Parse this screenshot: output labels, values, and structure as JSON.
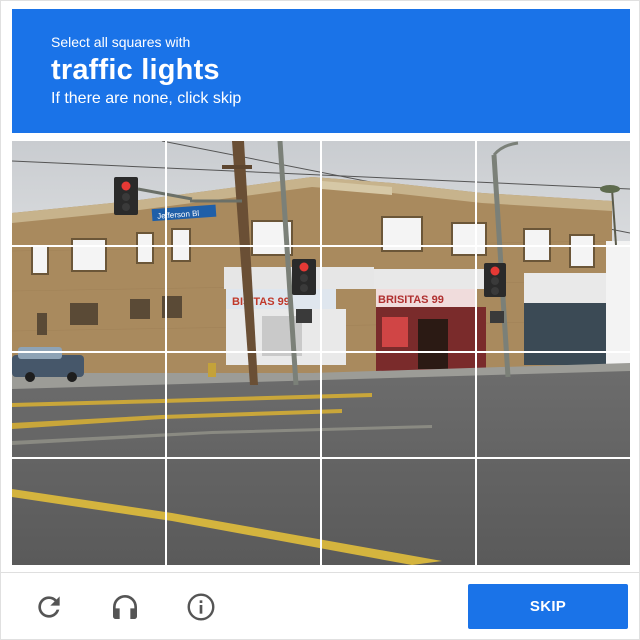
{
  "header": {
    "instruction": "Select all squares with",
    "target": "traffic lights",
    "hint": "If there are none, click skip",
    "background_color": "#1a73e8"
  },
  "scene": {
    "street_sign": "Jefferson Bl",
    "store_sign_left": "BISITAS 99",
    "store_sign_right": "BRISITAS 99"
  },
  "grid": {
    "rows": 4,
    "cols": 4
  },
  "footer": {
    "reload_icon": "reload-icon",
    "audio_icon": "headphones-icon",
    "info_icon": "info-icon",
    "skip_label": "SKIP",
    "skip_color": "#1a73e8"
  }
}
